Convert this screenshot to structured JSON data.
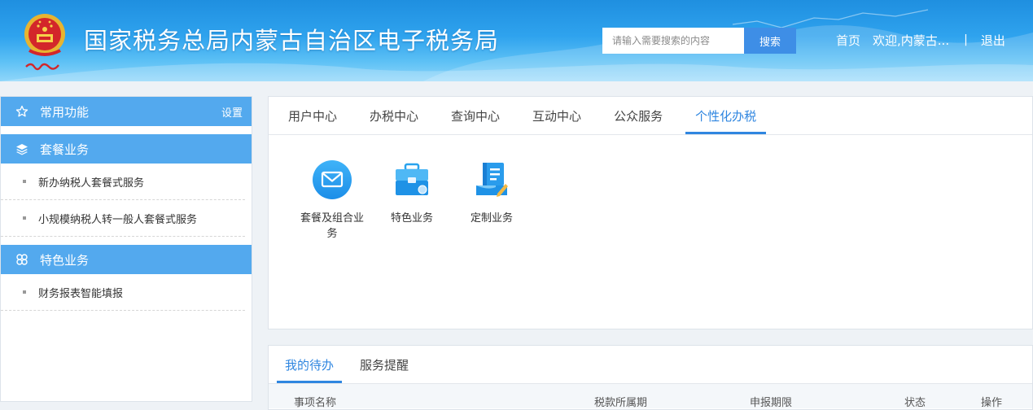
{
  "header": {
    "site_title": "国家税务总局内蒙古自治区电子税务局",
    "search_placeholder": "请输入需要搜索的内容",
    "search_button": "搜索",
    "home": "首页",
    "welcome": "欢迎,内蒙古...",
    "separator": "|",
    "logout": "退出"
  },
  "sidebar": {
    "favorites": {
      "title": "常用功能",
      "setting": "设置"
    },
    "package": {
      "title": "套餐业务",
      "items": [
        "新办纳税人套餐式服务",
        "小规模纳税人转一般人套餐式服务"
      ]
    },
    "special": {
      "title": "特色业务",
      "items": [
        "财务报表智能填报"
      ]
    }
  },
  "main": {
    "tabs": [
      "用户中心",
      "办税中心",
      "查询中心",
      "互动中心",
      "公众服务",
      "个性化办税"
    ],
    "active_tab": "个性化办税",
    "services": [
      {
        "label": "套餐及组合业务",
        "icon": "envelope-icon"
      },
      {
        "label": "特色业务",
        "icon": "briefcase-icon"
      },
      {
        "label": "定制业务",
        "icon": "document-pen-icon"
      }
    ]
  },
  "todo": {
    "tabs": [
      "我的待办",
      "服务提醒"
    ],
    "active_tab": "我的待办",
    "columns": [
      "事项名称",
      "税款所属期",
      "申报期限",
      "状态",
      "操作"
    ]
  },
  "colors": {
    "accent": "#2f86e0",
    "sidebar_header": "#53a9ee",
    "search_button": "#3e8ee6"
  }
}
